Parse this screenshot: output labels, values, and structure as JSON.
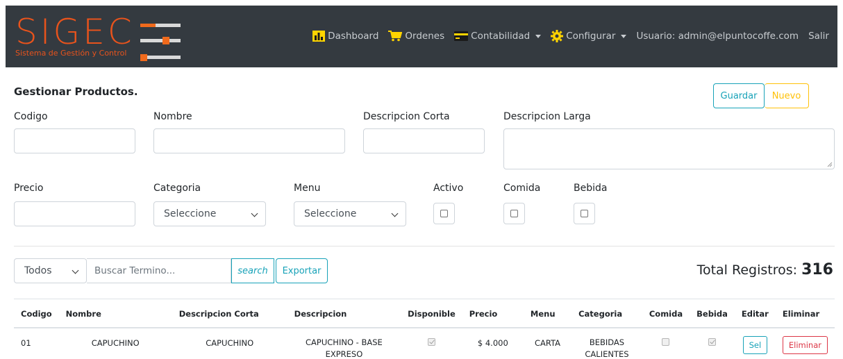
{
  "brand": {
    "title": "SIGEC",
    "subtitle": "Sistema de Gestión y Control"
  },
  "nav": {
    "dashboard": "Dashboard",
    "ordenes": "Ordenes",
    "contabilidad": "Contabilidad",
    "configurar": "Configurar",
    "usuario": "Usuario: admin@elpuntocoffe.com",
    "salir": "Salir"
  },
  "form": {
    "title": "Gestionar Productos.",
    "guardar": "Guardar",
    "nuevo": "Nuevo",
    "labels": {
      "codigo": "Codigo",
      "nombre": "Nombre",
      "desc_corta": "Descripcion Corta",
      "desc_larga": "Descripcion Larga",
      "precio": "Precio",
      "categoria": "Categoria",
      "menu": "Menu",
      "activo": "Activo",
      "comida": "Comida",
      "bebida": "Bebida"
    },
    "values": {
      "codigo": "",
      "nombre": "",
      "desc_corta": "",
      "desc_larga": "",
      "precio": ""
    },
    "categoria_selected": "Seleccione",
    "menu_selected": "Seleccione"
  },
  "toolbar": {
    "filter_selected": "Todos",
    "search_placeholder": "Buscar Termino...",
    "search_button": "search",
    "exportar": "Exportar",
    "total_label": "Total Registros: ",
    "total_value": "316"
  },
  "table": {
    "headers": [
      "Codigo",
      "Nombre",
      "Descripcion Corta",
      "Descripcion",
      "Disponible",
      "Precio",
      "Menu",
      "Categoria",
      "Comida",
      "Bebida",
      "Editar",
      "Eliminar"
    ],
    "rows": [
      {
        "codigo": "01",
        "nombre": "CAPUCHINO",
        "desc_corta": "CAPUCHINO",
        "descripcion": "CAPUCHINO - BASE EXPRESO",
        "disponible": true,
        "precio": "$ 4.000",
        "menu": "CARTA",
        "categoria": "BEBIDAS CALIENTES",
        "comida": false,
        "bebida": true,
        "editar": "Sel",
        "eliminar": "Eliminar"
      }
    ]
  },
  "colors": {
    "navbar": "#343a40",
    "brand": "#e8531c",
    "info": "#17a2b8",
    "warning": "#ffc107",
    "danger": "#dc3545"
  }
}
